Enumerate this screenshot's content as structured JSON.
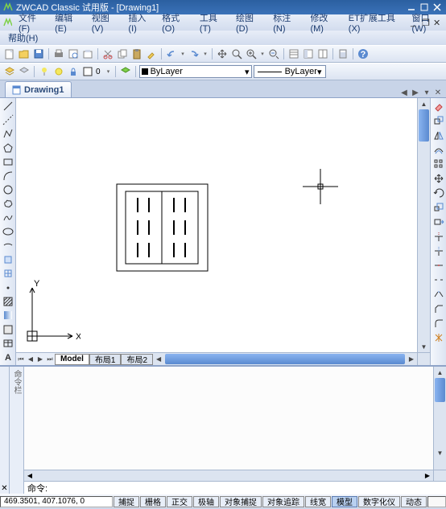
{
  "title": "ZWCAD Classic 试用版 - [Drawing1]",
  "menus": {
    "file": "文件(F)",
    "edit": "编辑(E)",
    "view": "视图(V)",
    "insert": "插入(I)",
    "format": "格式(O)",
    "tools": "工具(T)",
    "draw": "绘图(D)",
    "dimension": "标注(N)",
    "modify": "修改(M)",
    "etx": "ET扩展工具(X)",
    "window": "窗口(W)",
    "help": "帮助(H)"
  },
  "layer": {
    "current": "ByLayer",
    "color": "#000000"
  },
  "linetype": "ByLayer",
  "doctab": "Drawing1",
  "layout_tabs": {
    "model": "Model",
    "l1": "布局1",
    "l2": "布局2"
  },
  "ucs": {
    "x": "X",
    "y": "Y"
  },
  "sidetab": "命令栏",
  "cmd_prompt": "命令:",
  "coords": "469.3501, 407.1076, 0",
  "status": {
    "snap": "捕捉",
    "grid": "栅格",
    "ortho": "正交",
    "polar": "极轴",
    "osnap": "对象捕捉",
    "otrack": "对象追踪",
    "lwt": "线宽",
    "model": "模型",
    "digitizer": "数字化仪",
    "dyn": "动态"
  }
}
